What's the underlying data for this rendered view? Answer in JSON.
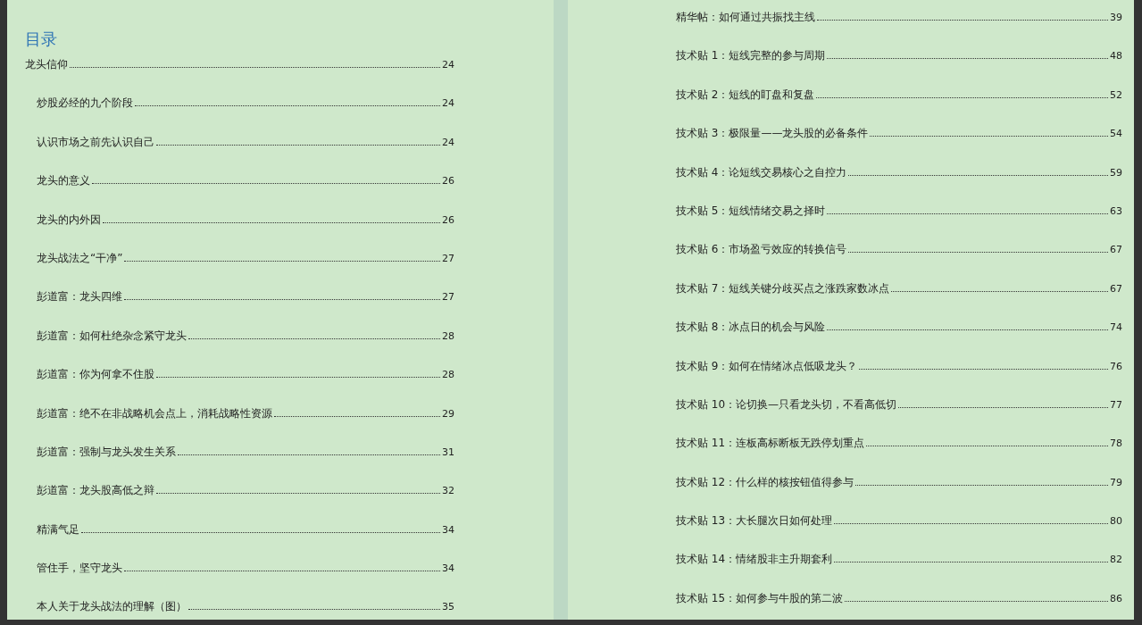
{
  "left_page": {
    "heading": "目录",
    "entries": [
      {
        "title": "龙头信仰",
        "page": "24",
        "children": [
          {
            "title": "炒股必经的九个阶段",
            "page": "24"
          },
          {
            "title": "认识市场之前先认识自己",
            "page": "24"
          },
          {
            "title": "龙头的意义",
            "page": "26"
          },
          {
            "title": "龙头的内外因",
            "page": "26"
          },
          {
            "title": "龙头战法之“干净”",
            "page": "27"
          },
          {
            "title": "彭道富：龙头四维",
            "page": "27"
          },
          {
            "title": "彭道富：如何杜绝杂念紧守龙头",
            "page": "28"
          },
          {
            "title": "彭道富：你为何拿不住股",
            "page": "28"
          },
          {
            "title": "彭道富：绝不在非战略机会点上，消耗战略性资源",
            "page": "29"
          },
          {
            "title": "彭道富：强制与龙头发生关系",
            "page": "31"
          },
          {
            "title": "彭道富：龙头股高低之辩",
            "page": "32"
          },
          {
            "title": "精满气足",
            "page": "34"
          },
          {
            "title": "管住手，坚守龙头",
            "page": "34"
          },
          {
            "title": "本人关于龙头战法的理解（图）",
            "page": "35"
          }
        ]
      }
    ]
  },
  "right_page": {
    "entries": [
      {
        "title": "精华帖：如何通过共振找主线",
        "page": "39"
      },
      {
        "title": "技术贴 1：短线完整的参与周期",
        "page": "48"
      },
      {
        "title": "技术贴 2：短线的盯盘和复盘",
        "page": "52"
      },
      {
        "title": "技术贴 3：极限量——龙头股的必备条件",
        "page": "54"
      },
      {
        "title": "技术贴 4：论短线交易核心之自控力",
        "page": "59"
      },
      {
        "title": "技术贴 5：短线情绪交易之择时",
        "page": "63"
      },
      {
        "title": "技术贴 6：市场盈亏效应的转换信号",
        "page": "67"
      },
      {
        "title": "技术贴 7：短线关键分歧买点之涨跌家数冰点",
        "page": "67"
      },
      {
        "title": "技术贴 8：冰点日的机会与风险",
        "page": "74"
      },
      {
        "title": "技术贴 9：如何在情绪冰点低吸龙头？",
        "page": "76"
      },
      {
        "title": "技术贴 10：论切换—只看龙头切，不看高低切",
        "page": "77"
      },
      {
        "title": "技术贴 11：连板高标断板无跌停划重点",
        "page": "78"
      },
      {
        "title": "技术贴 12：什么样的核按钮值得参与",
        "page": "79"
      },
      {
        "title": "技术贴 13：大长腿次日如何处理",
        "page": "80"
      },
      {
        "title": "技术贴 14：情绪股非主升期套利",
        "page": "82"
      },
      {
        "title": "技术贴 15：如何参与牛股的第二波",
        "page": "86"
      }
    ]
  }
}
